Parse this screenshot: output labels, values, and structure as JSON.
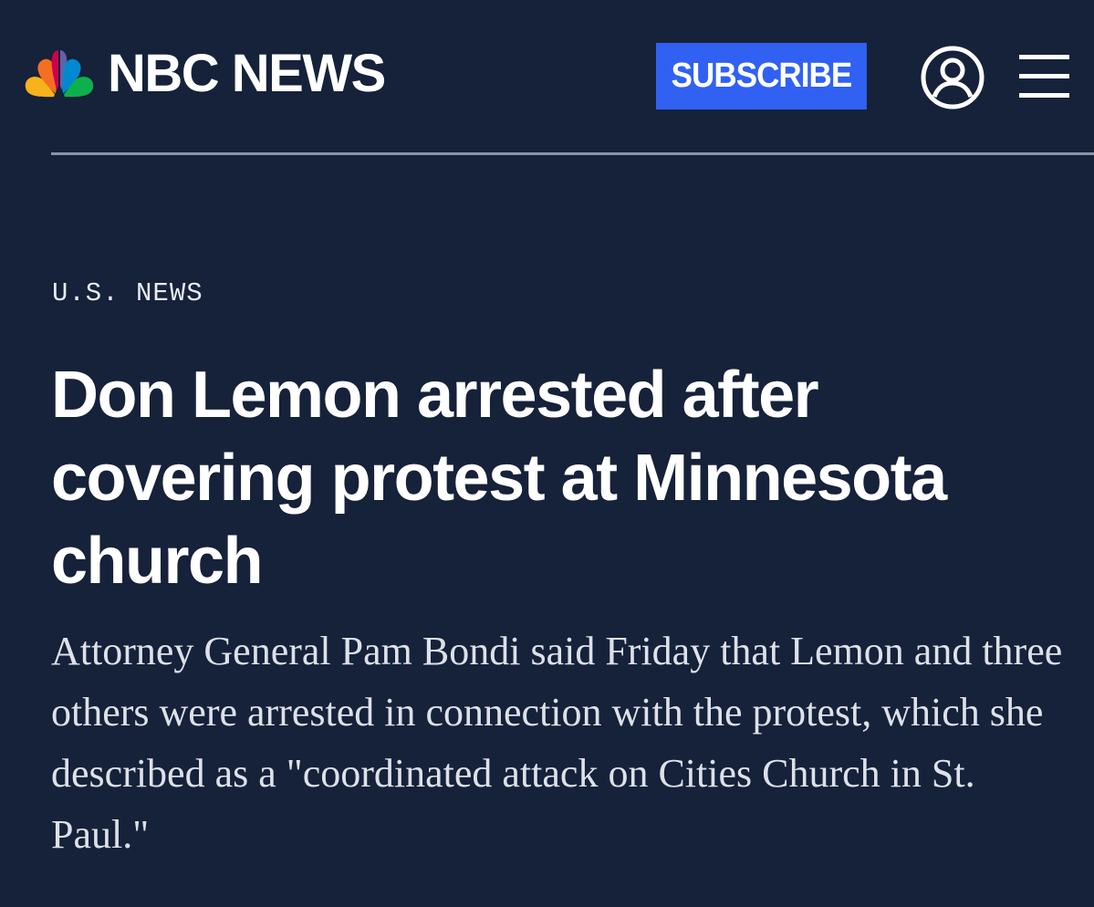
{
  "brand": {
    "name": "NBC NEWS",
    "peacock_colors": [
      "#f8b21b",
      "#f37021",
      "#cc004c",
      "#6460aa",
      "#0089d0",
      "#0db14b"
    ]
  },
  "header": {
    "subscribe_label": "SUBSCRIBE",
    "subscribe_color": "#3061f2",
    "account_icon": "user-circle-icon",
    "menu_icon": "hamburger-menu-icon"
  },
  "article": {
    "section": "U.S. NEWS",
    "headline": "Don Lemon arrested after covering protest at Minnesota church",
    "dek": "Attorney General Pam Bondi said Friday that Lemon and three others were arrested in connection with the protest, which she described as a \"coordinated attack on Cities Church in St. Paul.\""
  },
  "colors": {
    "background": "#16213a",
    "divider": "#8a93a4"
  }
}
